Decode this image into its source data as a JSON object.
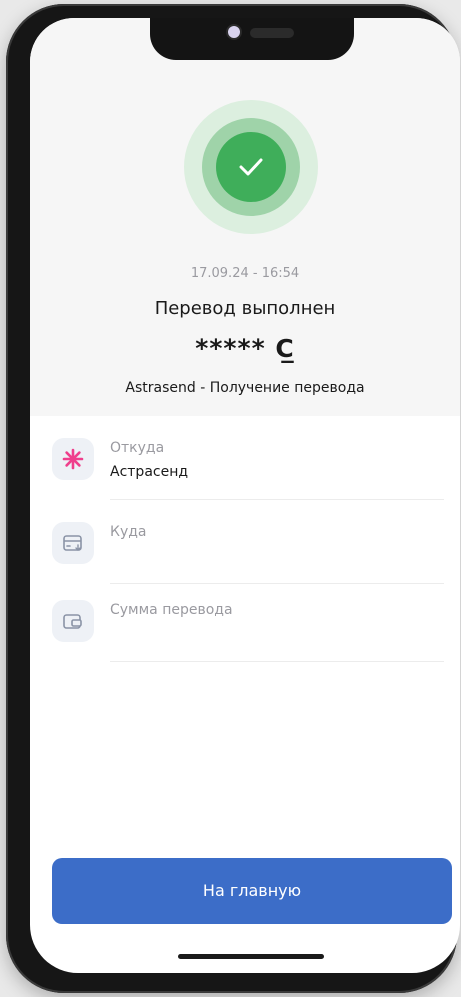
{
  "transfer": {
    "datetime": "17.09.24 - 16:54",
    "status": "Перевод выполнен",
    "amount": "***** С̲",
    "description": "Astrasend - Получение перевода"
  },
  "details": [
    {
      "label": "Откуда",
      "value": "Астрасенд",
      "icon": "astrasend-logo-icon"
    },
    {
      "label": "Куда",
      "value": "",
      "icon": "card-icon"
    },
    {
      "label": "Сумма перевода",
      "value": "",
      "icon": "wallet-icon"
    }
  ],
  "actions": {
    "home_label": "На главную"
  },
  "colors": {
    "success": "#3fae5a",
    "primary": "#3c6dc8",
    "brand_accent": "#ef3f8c"
  }
}
